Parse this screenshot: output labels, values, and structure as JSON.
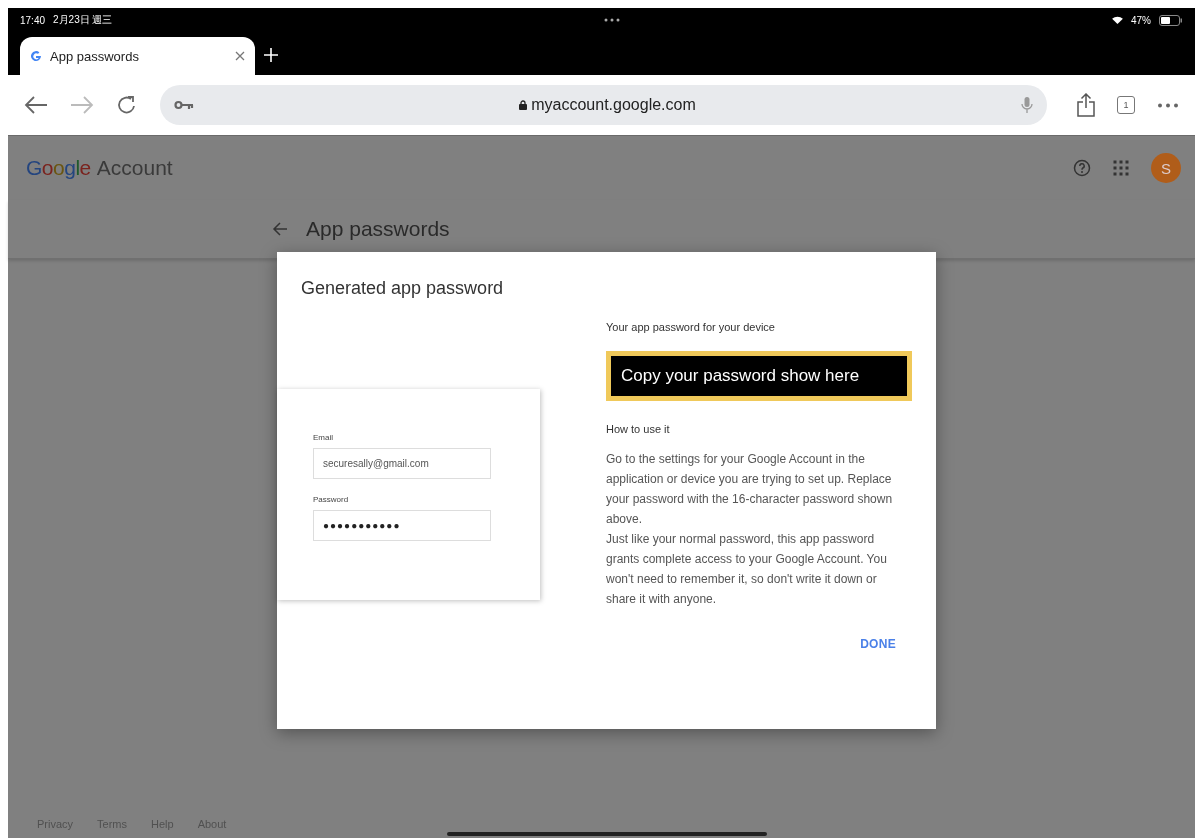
{
  "status_bar": {
    "time": "17:40",
    "date": "2月23日 週三",
    "battery_text": "47%"
  },
  "browser": {
    "tabs": [
      {
        "title": "App passwords",
        "selected": true
      }
    ],
    "url": "myaccount.google.com",
    "tab_count": "1"
  },
  "header": {
    "brand": "Google",
    "product": "Account",
    "avatar_letter": "S"
  },
  "page_title": "App passwords",
  "dialog": {
    "title": "Generated app password",
    "illustration": {
      "email_label": "Email",
      "email_value": "securesally@gmail.com",
      "password_label": "Password",
      "password_value": "●●●●●●●●●●●"
    },
    "password_caption": "Your app password for your device",
    "password_value": "Copy your password show here",
    "how_title": "How to use it",
    "paragraphs": [
      "Go to the settings for your Google Account in the application or device you are trying to set up. Replace your password with the 16-character password shown above.",
      "Just like your normal password, this app password grants complete access to your Google Account. You won't need to remember it, so don't write it down or share it with anyone."
    ],
    "done": "DONE"
  },
  "footer": [
    "Privacy",
    "Terms",
    "Help",
    "About"
  ]
}
